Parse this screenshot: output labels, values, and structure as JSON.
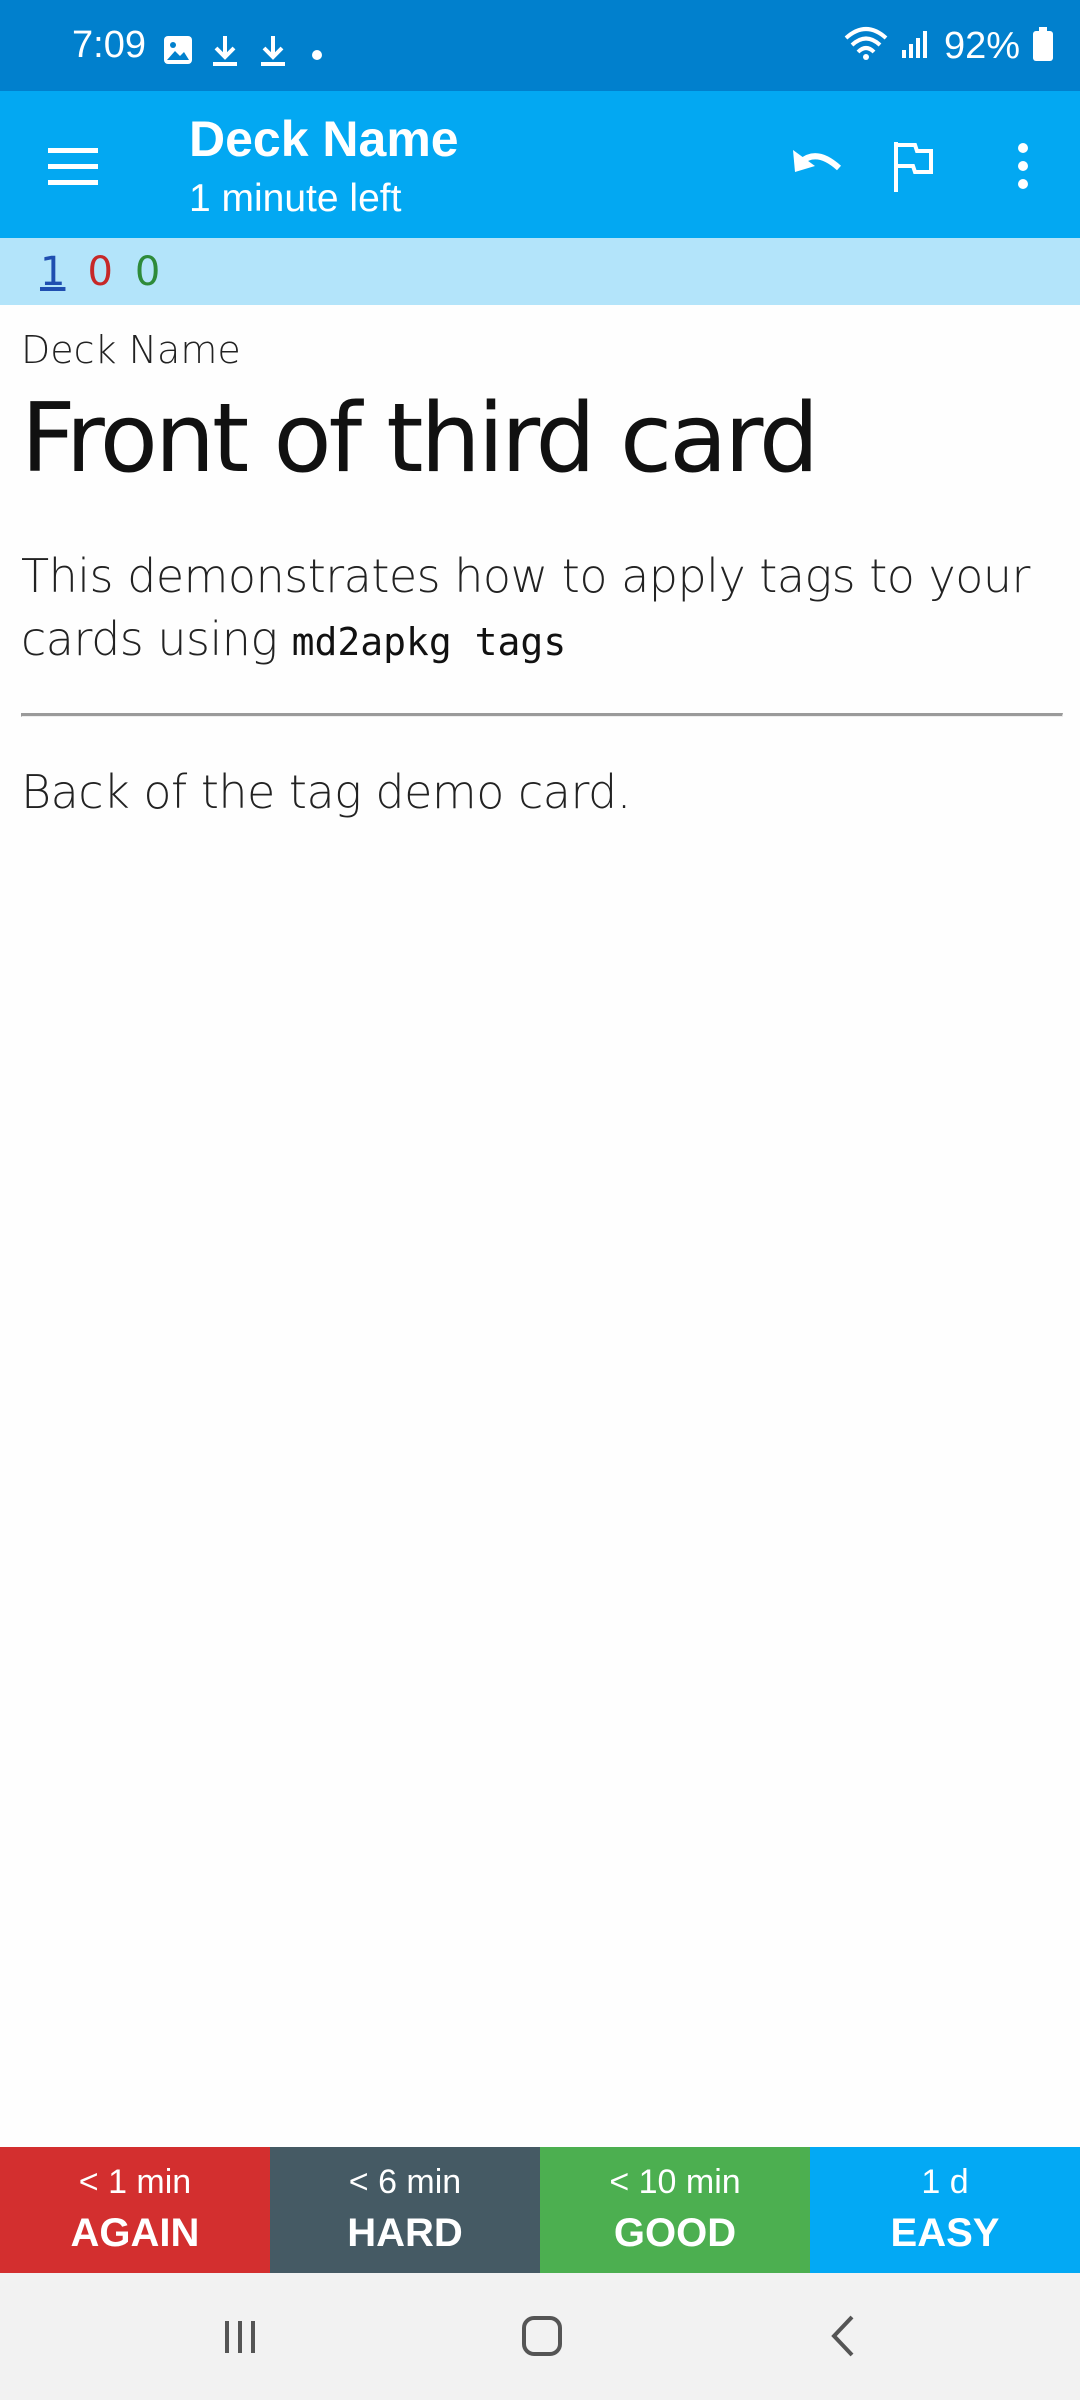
{
  "status_bar": {
    "time": "7:09",
    "battery": "92%",
    "icons": [
      "image-icon",
      "download-icon",
      "download-icon",
      "dot-icon",
      "wifi-icon",
      "signal-icon",
      "battery-icon"
    ]
  },
  "app_bar": {
    "title": "Deck Name",
    "subtitle": "1 minute left",
    "actions": [
      "menu-icon",
      "undo-icon",
      "flag-icon",
      "more-vert-icon"
    ]
  },
  "counts": {
    "new": "1",
    "learning": "0",
    "review": "0"
  },
  "card": {
    "deck_label": "Deck Name",
    "front_title": "Front of third card",
    "front_text": "This demonstrates how to apply tags to your cards using ",
    "front_code": "md2apkg tags",
    "back_text": "Back of the tag demo card."
  },
  "answer_buttons": [
    {
      "interval": "< 1 min",
      "label": "AGAIN",
      "color": "#d32f2f"
    },
    {
      "interval": "< 6 min",
      "label": "HARD",
      "color": "#455a64"
    },
    {
      "interval": "< 10 min",
      "label": "GOOD",
      "color": "#4caf50"
    },
    {
      "interval": "1 d",
      "label": "EASY",
      "color": "#03a9f4"
    }
  ],
  "colors": {
    "status_bar": "#0180cd",
    "app_bar": "#03a8f2",
    "count_bar": "#b3e4fa",
    "nav_bar": "#f2f2f2"
  },
  "nav_bar": {
    "icons": [
      "recent-apps-icon",
      "home-icon",
      "back-icon"
    ]
  }
}
